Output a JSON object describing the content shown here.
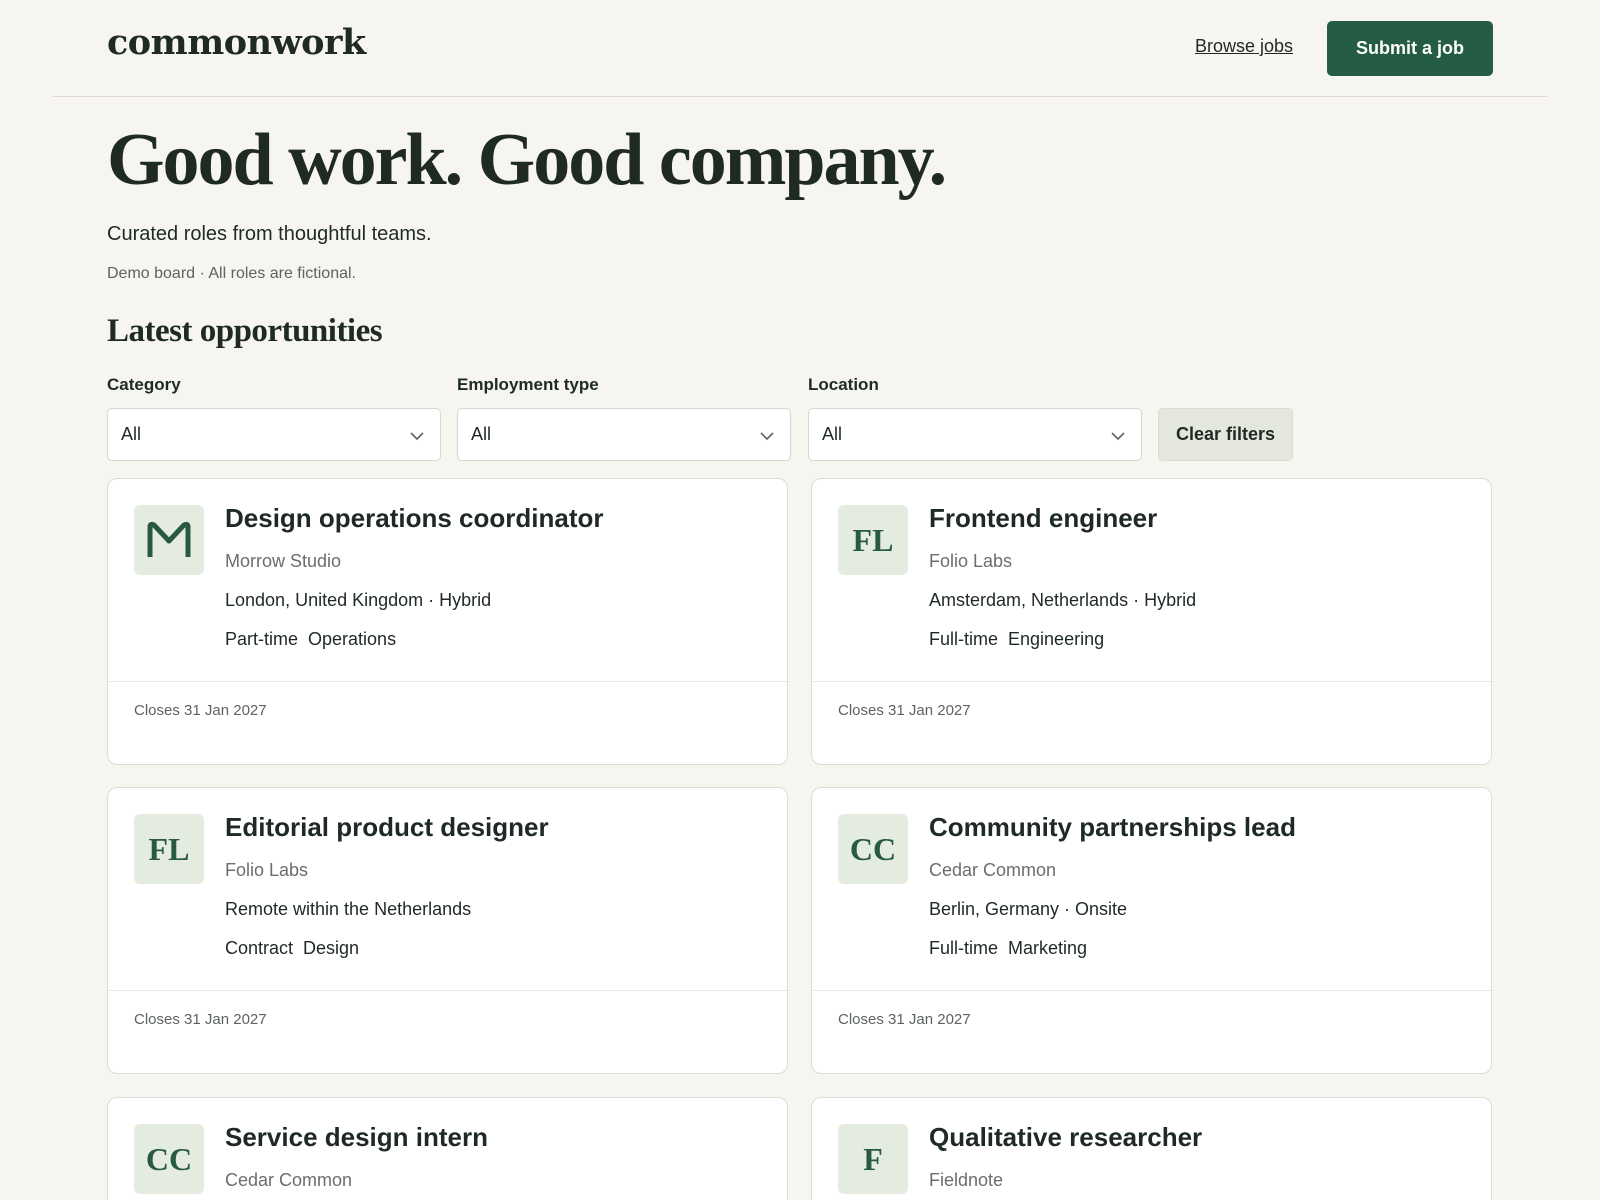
{
  "header": {
    "logo": "commonwork",
    "browse_link": "Browse jobs",
    "submit_label": "Submit a job"
  },
  "hero": {
    "title": "Good work. Good company.",
    "subtitle": "Curated roles from thoughtful teams.",
    "note": "Demo board · All roles are fictional."
  },
  "section_title": "Latest opportunities",
  "filters": {
    "category": {
      "label": "Category",
      "value": "All"
    },
    "employment": {
      "label": "Employment type",
      "value": "All"
    },
    "location": {
      "label": "Location",
      "value": "All"
    },
    "clear_label": "Clear filters"
  },
  "jobs": [
    {
      "logo": "",
      "logo_icon": "morrow-studio-m-logo-icon",
      "title": "Design operations coordinator",
      "company": "Morrow Studio",
      "location": "London, United Kingdom · Hybrid",
      "type": "Part-time",
      "category": "Operations",
      "closes": "Closes 31 Jan 2027"
    },
    {
      "logo": "FL",
      "title": "Frontend engineer",
      "company": "Folio Labs",
      "location": "Amsterdam, Netherlands · Hybrid",
      "type": "Full-time",
      "category": "Engineering",
      "closes": "Closes 31 Jan 2027"
    },
    {
      "logo": "FL",
      "title": "Editorial product designer",
      "company": "Folio Labs",
      "location": "Remote within the Netherlands",
      "type": "Contract",
      "category": "Design",
      "closes": "Closes 31 Jan 2027"
    },
    {
      "logo": "CC",
      "title": "Community partnerships lead",
      "company": "Cedar Common",
      "location": "Berlin, Germany · Onsite",
      "type": "Full-time",
      "category": "Marketing",
      "closes": "Closes 31 Jan 2027"
    },
    {
      "logo": "CC",
      "title": "Service design intern",
      "company": "Cedar Common"
    },
    {
      "logo": "F",
      "title": "Qualitative researcher",
      "company": "Fieldnote"
    }
  ],
  "colors": {
    "background": "#f6f5f0",
    "accent": "#255c44",
    "logo_tile": "#e4ebdf",
    "text": "#1f2a24"
  }
}
